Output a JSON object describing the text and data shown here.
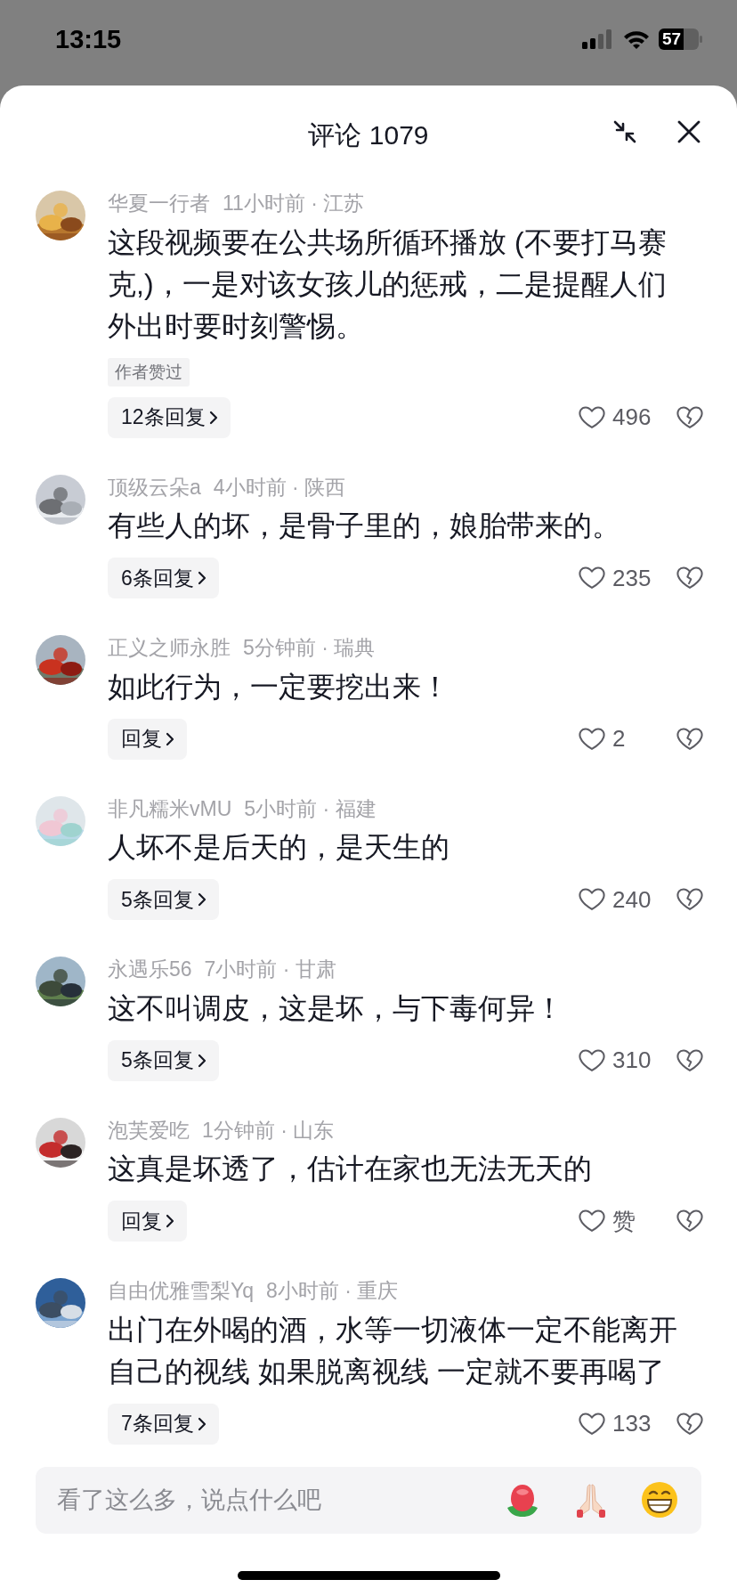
{
  "status_bar": {
    "time": "13:15",
    "battery": "57"
  },
  "header": {
    "title": "评论 1079"
  },
  "comments": [
    {
      "author": "华夏一行者",
      "meta": "11小时前 · 江苏",
      "text": "这段视频要在公共场所循环播放 (不要打马赛克,)，一是对该女孩儿的惩戒，二是提醒人们外出时要时刻警惕。",
      "tag": "作者赞过",
      "replies": "12条回复",
      "likes": "496"
    },
    {
      "author": "顶级云朵a",
      "meta": "4小时前 · 陕西",
      "text": "有些人的坏，是骨子里的，娘胎带来的。",
      "replies": "6条回复",
      "likes": "235"
    },
    {
      "author": "正义之师永胜",
      "meta": "5分钟前 · 瑞典",
      "text": "如此行为，一定要挖出来！",
      "replies": "回复",
      "likes": "2"
    },
    {
      "author": "非凡糯米vMU",
      "meta": "5小时前 · 福建",
      "text": "人坏不是后天的，是天生的",
      "replies": "5条回复",
      "likes": "240"
    },
    {
      "author": "永遇乐56",
      "meta": "7小时前 · 甘肃",
      "text": "这不叫调皮，这是坏，与下毒何异！",
      "replies": "5条回复",
      "likes": "310"
    },
    {
      "author": "泡芙爱吃",
      "meta": "1分钟前 · 山东",
      "text": "这真是坏透了，估计在家也无法无天的",
      "replies": "回复",
      "likes": "赞"
    },
    {
      "author": "自由优雅雪梨Yq",
      "meta": "8小时前 · 重庆",
      "text": "出门在外喝的酒，水等一切液体一定不能离开自己的视线 如果脱离视线 一定就不要再喝了",
      "replies": "7条回复",
      "likes": "133"
    }
  ],
  "input": {
    "placeholder": "看了这么多，说点什么吧"
  }
}
